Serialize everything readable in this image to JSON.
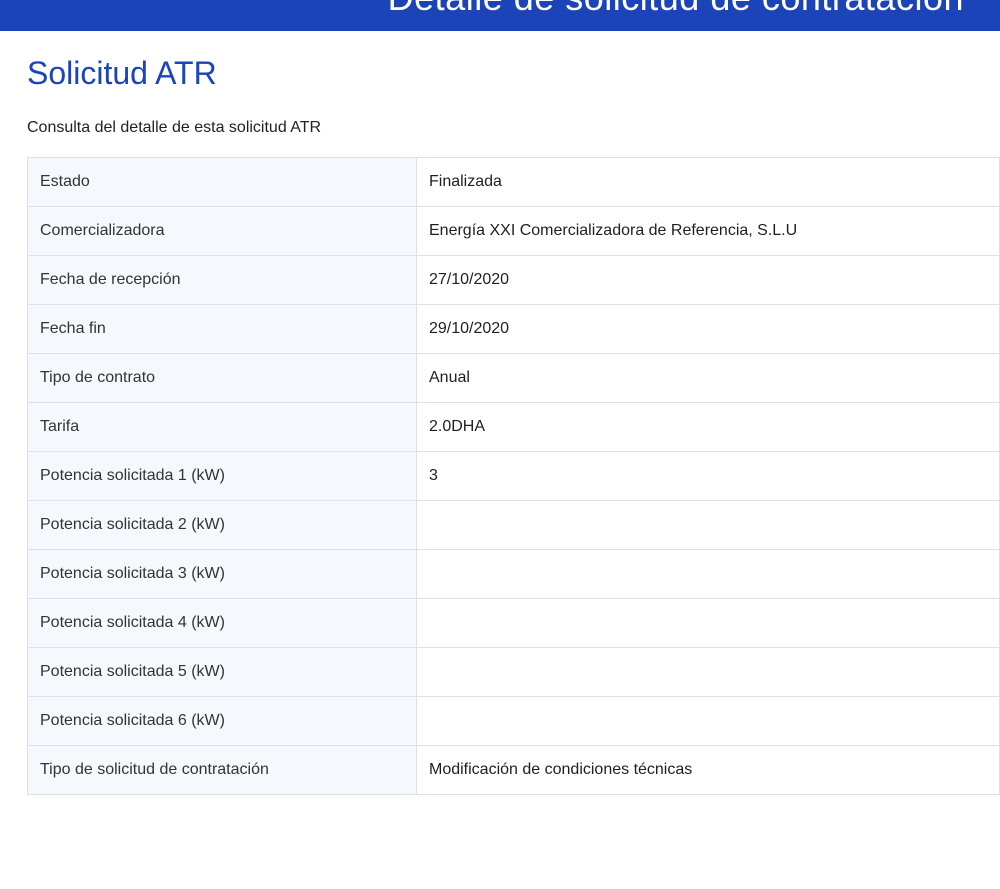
{
  "header": {
    "title": "Detalle de solicitud de contratación"
  },
  "page": {
    "title": "Solicitud ATR",
    "subtitle": "Consulta del detalle de esta solicitud ATR"
  },
  "details": {
    "rows": [
      {
        "label": "Estado",
        "value": "Finalizada"
      },
      {
        "label": "Comercializadora",
        "value": "Energía XXI Comercializadora de Referencia, S.L.U"
      },
      {
        "label": "Fecha de recepción",
        "value": "27/10/2020"
      },
      {
        "label": "Fecha fin",
        "value": "29/10/2020"
      },
      {
        "label": "Tipo de contrato",
        "value": "Anual"
      },
      {
        "label": "Tarifa",
        "value": "2.0DHA"
      },
      {
        "label": "Potencia solicitada 1 (kW)",
        "value": "3"
      },
      {
        "label": "Potencia solicitada 2 (kW)",
        "value": ""
      },
      {
        "label": "Potencia solicitada 3 (kW)",
        "value": ""
      },
      {
        "label": "Potencia solicitada 4 (kW)",
        "value": ""
      },
      {
        "label": "Potencia solicitada 5 (kW)",
        "value": ""
      },
      {
        "label": "Potencia solicitada 6 (kW)",
        "value": ""
      },
      {
        "label": "Tipo de solicitud de contratación",
        "value": "Modificación de condiciones técnicas"
      }
    ]
  },
  "colors": {
    "header_background": "#1a44b8",
    "title_color": "#1a44b8",
    "label_cell_background": "#f5f8fc",
    "border": "#dde2ea"
  }
}
